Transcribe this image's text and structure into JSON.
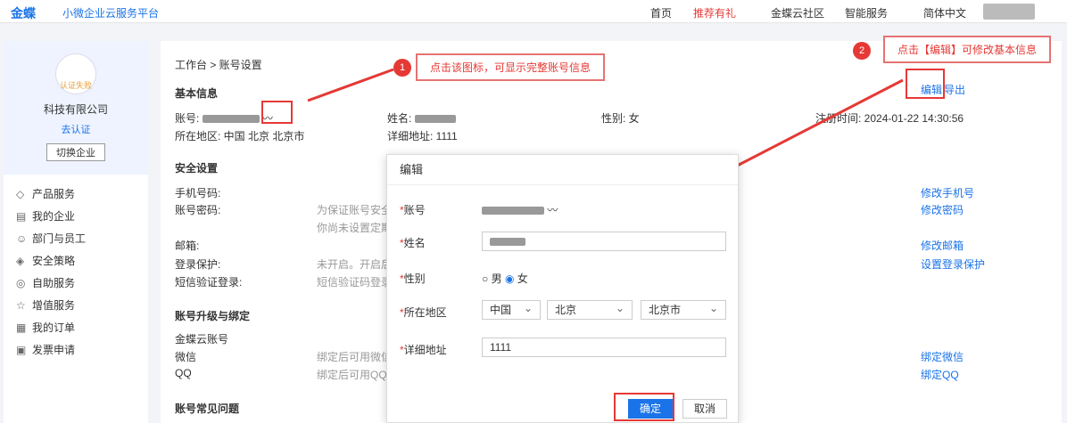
{
  "top": {
    "logo": "金蝶",
    "brand": "小微企业云服务平台",
    "nav": [
      "首页",
      "推荐有礼",
      "金蝶云社区",
      "智能服务",
      "简体中文"
    ]
  },
  "side": {
    "status": "认证失败",
    "company": "科技有限公司",
    "auth": "去认证",
    "switch": "切换企业",
    "menu": [
      "产品服务",
      "我的企业",
      "部门与员工",
      "安全策略",
      "自助服务",
      "增值服务",
      "我的订单",
      "发票申请"
    ]
  },
  "crumb": "工作台 > 账号设置",
  "basic": {
    "title": "基本信息",
    "account": "账号:",
    "name": "姓名:",
    "gender": "性别: 女",
    "reg": "注册时间: 2024-01-22 14:30:56",
    "area": "所在地区: 中国 北京 北京市",
    "addr": "详细地址: 1111",
    "edit": "编辑",
    "export": "导出"
  },
  "security": {
    "title": "安全设置",
    "rows": [
      "手机号码:",
      "账号密码:",
      "邮箱:",
      "登录保护:",
      "短信验证登录:"
    ],
    "links": [
      "修改手机号",
      "修改密码",
      "修改邮箱",
      "设置登录保护"
    ],
    "pwd": "为保证账号安全",
    "pwd2": "你尚未设置定期",
    "protect": "未开启。开启后",
    "sms": "短信验证码登录"
  },
  "upgrade": {
    "title": "账号升级与绑定",
    "rows": [
      "金蝶云账号",
      "微信",
      "QQ"
    ],
    "wx": "绑定后可用微信",
    "qq": "绑定后可用QQ",
    "links": [
      "绑定微信",
      "绑定QQ"
    ]
  },
  "faq": "账号常见问题",
  "callouts": {
    "c1": "点击该图标，可显示完整账号信息",
    "c2": "点击【编辑】可修改基本信息"
  },
  "modal": {
    "title": "编辑",
    "account": "账号",
    "name": "姓名",
    "gender": "性别",
    "male": "男",
    "female": "女",
    "area": "所在地区",
    "country": "中国",
    "prov": "北京",
    "city": "北京市",
    "addr": "详细地址",
    "addr_val": "1111",
    "ok": "确定",
    "cancel": "取消"
  }
}
